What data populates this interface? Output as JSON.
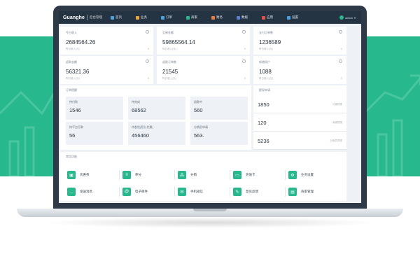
{
  "theme": {
    "brand": "#27b88e",
    "navbar": "#253442",
    "page_bg": "#eef1f5"
  },
  "navbar": {
    "logo": "Guanghe",
    "logo_sub": "后台管理",
    "items": [
      {
        "label": "首页",
        "icon": "home-icon",
        "color": "#4aa3df"
      },
      {
        "label": "业务",
        "icon": "business-icon",
        "color": "#f0a43a"
      },
      {
        "label": "订单",
        "icon": "order-icon",
        "color": "#4aa3df"
      },
      {
        "label": "商家",
        "icon": "merchant-icon",
        "color": "#27b88e"
      },
      {
        "label": "财务",
        "icon": "finance-icon",
        "color": "#f07b3a"
      },
      {
        "label": "数据",
        "icon": "data-icon",
        "color": "#5a7fd6"
      },
      {
        "label": "应用",
        "icon": "app-icon",
        "color": "#e0504a"
      },
      {
        "label": "设置",
        "icon": "settings-icon",
        "color": "#4aa3df"
      }
    ],
    "user": "admin"
  },
  "stats": [
    {
      "label": "今日收入",
      "value": "2684564.26",
      "sub": "昨日收入(元)",
      "pct": "0"
    },
    {
      "label": "交易金额",
      "value": "59865564.14",
      "sub": "昨日收入(元)",
      "pct": "0"
    },
    {
      "label": "支付订单数",
      "value": "1236589",
      "sub": "昨日收入(元)",
      "pct": "0"
    },
    {
      "label": "退款金额",
      "value": "56321.36",
      "sub": "昨日收入(元)",
      "pct": "0"
    },
    {
      "label": "退款订单数",
      "value": "21545",
      "sub": "昨日收入(元)",
      "pct": "0"
    },
    {
      "label": "新增用户",
      "value": "1088",
      "sub": "昨日收入(元)",
      "pct": "0"
    }
  ],
  "orders": {
    "title": "订单提醒",
    "items": [
      {
        "label": "待付款",
        "value": "1546"
      },
      {
        "label": "待完成",
        "value": "68562"
      },
      {
        "label": "退款中",
        "value": "560"
      },
      {
        "label": "待平台打款",
        "value": "56"
      },
      {
        "label": "待发货(积分兑换)",
        "value": "456460"
      },
      {
        "label": "分销员申请",
        "value": "563."
      }
    ]
  },
  "review": {
    "title": "提现申请",
    "items": [
      {
        "value": "1850",
        "tag": "分销提现"
      },
      {
        "value": "120",
        "tag": "商家提现"
      },
      {
        "value": "5236",
        "tag": "分销员提现"
      }
    ]
  },
  "functions": {
    "title": "常用功能",
    "items": [
      {
        "label": "优惠券",
        "icon": "coupon-icon",
        "glyph": "▣"
      },
      {
        "label": "积分",
        "icon": "points-icon",
        "glyph": "≡"
      },
      {
        "label": "分销",
        "icon": "distribution-icon",
        "glyph": "⁂"
      },
      {
        "label": "充值卡",
        "icon": "recharge-card-icon",
        "glyph": "▭"
      },
      {
        "label": "业务设置",
        "icon": "gear-icon",
        "glyph": "⚙"
      },
      {
        "label": "发送消息",
        "icon": "message-icon",
        "glyph": "…"
      },
      {
        "label": "电子邮件",
        "icon": "email-icon",
        "glyph": "@"
      },
      {
        "label": "手机短信",
        "icon": "sms-icon",
        "glyph": "✉"
      },
      {
        "label": "意见反馈",
        "icon": "feedback-icon",
        "glyph": "✎"
      },
      {
        "label": "商家管理",
        "icon": "merchant-manage-icon",
        "glyph": "▤"
      }
    ]
  }
}
